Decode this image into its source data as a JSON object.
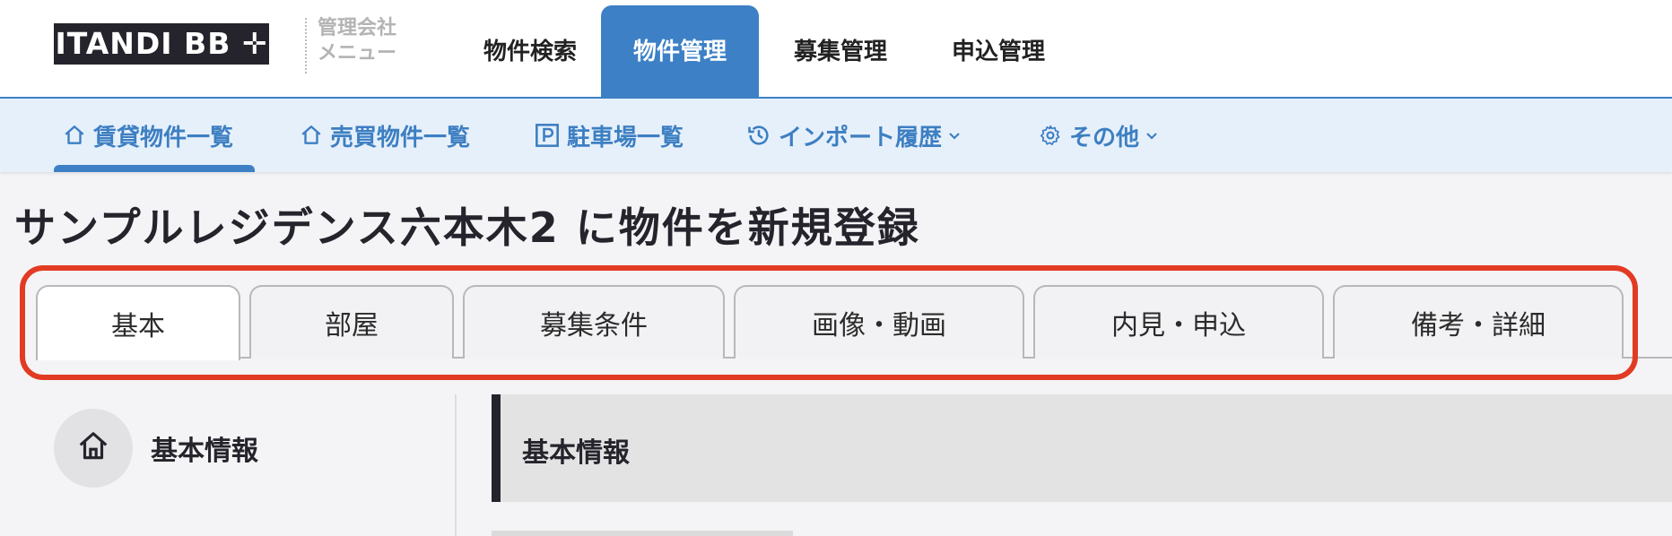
{
  "header": {
    "logo_text": "ITANDI BB ✛",
    "company_menu": [
      "管理会社",
      "メニュー"
    ],
    "main_tabs": [
      {
        "label": "物件検索",
        "active": false
      },
      {
        "label": "物件管理",
        "active": true
      },
      {
        "label": "募集管理",
        "active": false
      },
      {
        "label": "申込管理",
        "active": false
      }
    ]
  },
  "subnav": {
    "items": [
      {
        "label": "賃貸物件一覧",
        "icon": "home-icon",
        "active": true
      },
      {
        "label": "売買物件一覧",
        "icon": "home-icon",
        "active": false
      },
      {
        "label": "駐車場一覧",
        "icon": "parking-icon",
        "active": false
      },
      {
        "label": "インポート履歴",
        "icon": "history-icon",
        "dropdown": true
      },
      {
        "label": "その他",
        "icon": "gear-icon",
        "dropdown": true
      }
    ]
  },
  "page": {
    "title": "サンプルレジデンス六本木2 に物件を新規登録"
  },
  "tabs": [
    {
      "label": "基本",
      "active": true
    },
    {
      "label": "部屋",
      "active": false
    },
    {
      "label": "募集条件",
      "active": false
    },
    {
      "label": "画像・動画",
      "active": false
    },
    {
      "label": "内見・申込",
      "active": false
    },
    {
      "label": "備考・詳細",
      "active": false
    }
  ],
  "sidebar": {
    "section_label": "基本情報",
    "icon": "home-icon"
  },
  "main": {
    "section_title": "基本情報"
  },
  "colors": {
    "accent": "#3d80c6",
    "subnav_bg": "#e6f0fb",
    "highlight": "#e23b23",
    "dark": "#25232b"
  }
}
